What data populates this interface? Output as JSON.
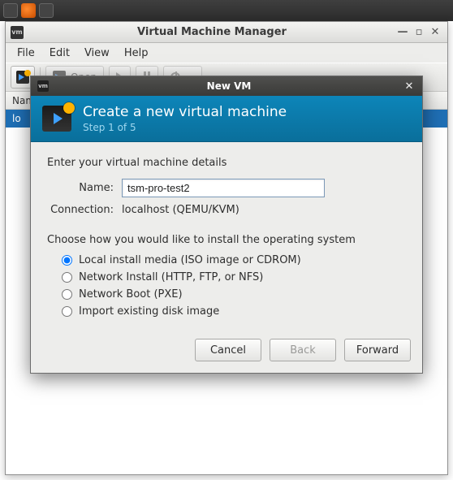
{
  "window": {
    "title": "Virtual Machine Manager",
    "menubar": [
      "File",
      "Edit",
      "View",
      "Help"
    ],
    "toolbar": {
      "open_label": "Open"
    },
    "list": {
      "header": "Nam",
      "row0": "lo"
    }
  },
  "dialog": {
    "title": "New VM",
    "banner": {
      "heading": "Create a new virtual machine",
      "step": "Step 1 of 5"
    },
    "body": {
      "prompt1": "Enter your virtual machine details",
      "name_label": "Name:",
      "name_value": "tsm-pro-test2",
      "connection_label": "Connection:",
      "connection_value": "localhost (QEMU/KVM)",
      "prompt2": "Choose how you would like to install the operating system",
      "options": [
        "Local install media (ISO image or CDROM)",
        "Network Install (HTTP, FTP, or NFS)",
        "Network Boot (PXE)",
        "Import existing disk image"
      ],
      "selected_index": 0
    },
    "buttons": {
      "cancel": "Cancel",
      "back": "Back",
      "forward": "Forward"
    }
  }
}
